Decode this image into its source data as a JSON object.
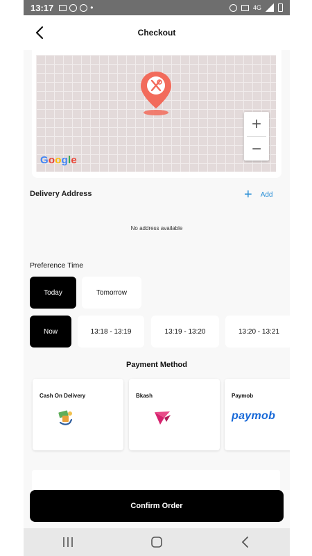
{
  "status_bar": {
    "time": "13:17",
    "network": "4G"
  },
  "header": {
    "title": "Checkout"
  },
  "map": {
    "attribution": "Google",
    "zoom_in": "+",
    "zoom_out": "−"
  },
  "delivery": {
    "label": "Delivery Address",
    "add_label": "Add",
    "empty_text": "No address available"
  },
  "preference": {
    "label": "Preference Time",
    "days": [
      {
        "label": "Today",
        "selected": true
      },
      {
        "label": "Tomorrow",
        "selected": false
      }
    ],
    "slots": [
      {
        "label": "Now",
        "selected": true
      },
      {
        "label": "13:18 - 13:19",
        "selected": false
      },
      {
        "label": "13:19 - 13:20",
        "selected": false
      },
      {
        "label": "13:20 - 13:21",
        "selected": false
      }
    ]
  },
  "payment": {
    "title": "Payment Method",
    "methods": [
      {
        "label": "Cash On Delivery",
        "icon": "cash-hand-icon"
      },
      {
        "label": "Bkash",
        "icon": "bkash-bird-icon"
      },
      {
        "label": "Paymob",
        "logo_text": "paymob"
      }
    ]
  },
  "confirm": {
    "label": "Confirm Order"
  },
  "colors": {
    "accent": "#2a8fd6",
    "pin": "#f26b5b",
    "primary": "#000000",
    "paymob": "#1668d8",
    "bkash": "#d6226e"
  }
}
